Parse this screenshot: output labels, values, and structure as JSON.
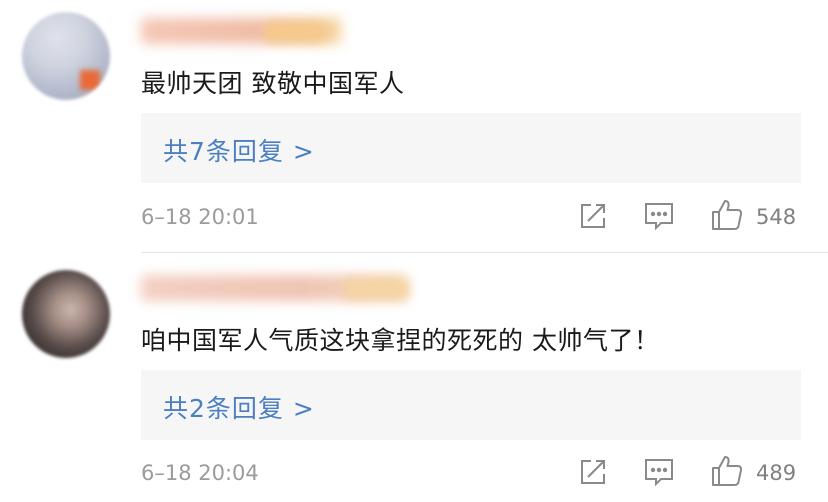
{
  "comments": [
    {
      "text": "最帅天团 致敬中国军人",
      "replies_label": "共7条回复 >",
      "time": "6–18 20:01",
      "likes": "548"
    },
    {
      "text": "咱中国军人气质这块拿捏的死死的 太帅气了！",
      "replies_label": "共2条回复 >",
      "time": "6–18 20:04",
      "likes": "489"
    }
  ],
  "icons": {
    "share": "share-icon",
    "comment": "comment-icon",
    "like": "thumbs-up-icon"
  },
  "colors": {
    "reply_link": "#4a7fc2",
    "meta_text": "#9b9b9b",
    "reply_box_bg": "#f6f6f6"
  }
}
